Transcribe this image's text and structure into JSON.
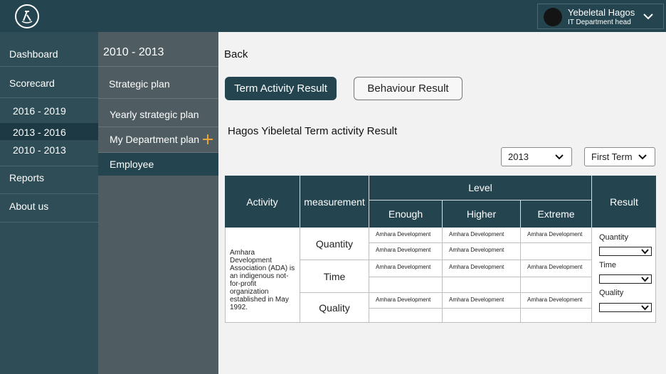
{
  "header": {
    "user_name": "Yebeletal Hagos",
    "user_role": "IT Department head"
  },
  "sidebar": {
    "dashboard": "Dashboard",
    "scorecard": "Scorecard",
    "terms": [
      "2016 - 2019",
      "2013 - 2016",
      "2010 - 2013"
    ],
    "reports": "Reports",
    "about": "About us"
  },
  "subnav": {
    "title": "2010 - 2013",
    "items": [
      "Strategic plan",
      "Yearly strategic plan",
      "My Department plan",
      "Employee"
    ]
  },
  "main": {
    "back": "Back",
    "tab_term": "Term Activity Result",
    "tab_behaviour": "Behaviour Result",
    "title": "Hagos Yibeletal Term activity Result",
    "year_select": "2013",
    "term_select": "First Term"
  },
  "table": {
    "headers": {
      "activity": "Activity",
      "measurement": "measurement",
      "level": "Level",
      "result": "Result",
      "enough": "Enough",
      "higher": "Higher",
      "extreme": "Extreme"
    },
    "activity_text": "Amhara Development Association (ADA) is an indigenous not-for-profit organization established in May 1992.",
    "measurements": [
      "Quantity",
      "Time",
      "Quality"
    ],
    "level_rows": [
      [
        "Amhara Development",
        "Amhara Development",
        "Amhara Development"
      ],
      [
        "Amhara Development",
        "Amhara Development",
        ""
      ],
      [
        "Amhara Development",
        "Amhara Development",
        "Amhara Development"
      ],
      [
        "",
        "",
        ""
      ],
      [
        "Amhara Development",
        "Amhara Development",
        "Amhara Development"
      ],
      [
        "",
        "",
        ""
      ]
    ],
    "result_labels": [
      "Quantity",
      "Time",
      "Quality"
    ]
  }
}
